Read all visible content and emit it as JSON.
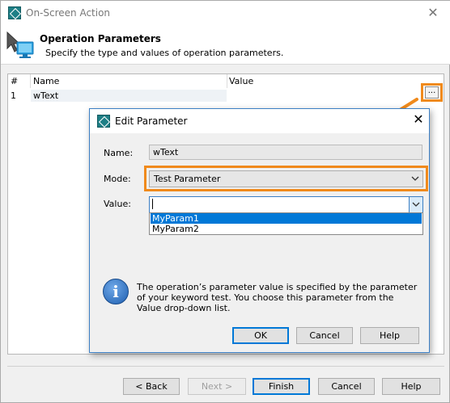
{
  "window": {
    "title": "On-Screen Action",
    "close_glyph": "✕"
  },
  "header": {
    "title": "Operation Parameters",
    "subtitle": "Specify the type and values of operation parameters."
  },
  "grid": {
    "columns": [
      "#",
      "Name",
      "Value"
    ],
    "rows": [
      {
        "index": "1",
        "name": "wText",
        "value": ""
      }
    ],
    "ellipsis_label": "..."
  },
  "dialog": {
    "title": "Edit Parameter",
    "close_glyph": "✕",
    "name_label": "Name:",
    "name_value": "wText",
    "mode_label": "Mode:",
    "mode_value": "Test Parameter",
    "value_label": "Value:",
    "value_text": "",
    "value_options": [
      "MyParam1",
      "MyParam2"
    ],
    "info_text": "The operation’s parameter value is specified by the parameter of your keyword test. You choose this parameter from the Value drop-down list.",
    "buttons": {
      "ok": "OK",
      "cancel": "Cancel",
      "help": "Help"
    }
  },
  "footer": {
    "back": "< Back",
    "next": "Next >",
    "finish": "Finish",
    "cancel": "Cancel",
    "help": "Help"
  },
  "icons": {
    "app": "testcomplete-logo-icon",
    "header": "monitor-cursor-icon",
    "info": "info-icon",
    "arrow": "orange-callout-arrow"
  },
  "colors": {
    "highlight": "#f08a1c",
    "selection": "#0078d7",
    "accent": "#3c7fc4"
  }
}
